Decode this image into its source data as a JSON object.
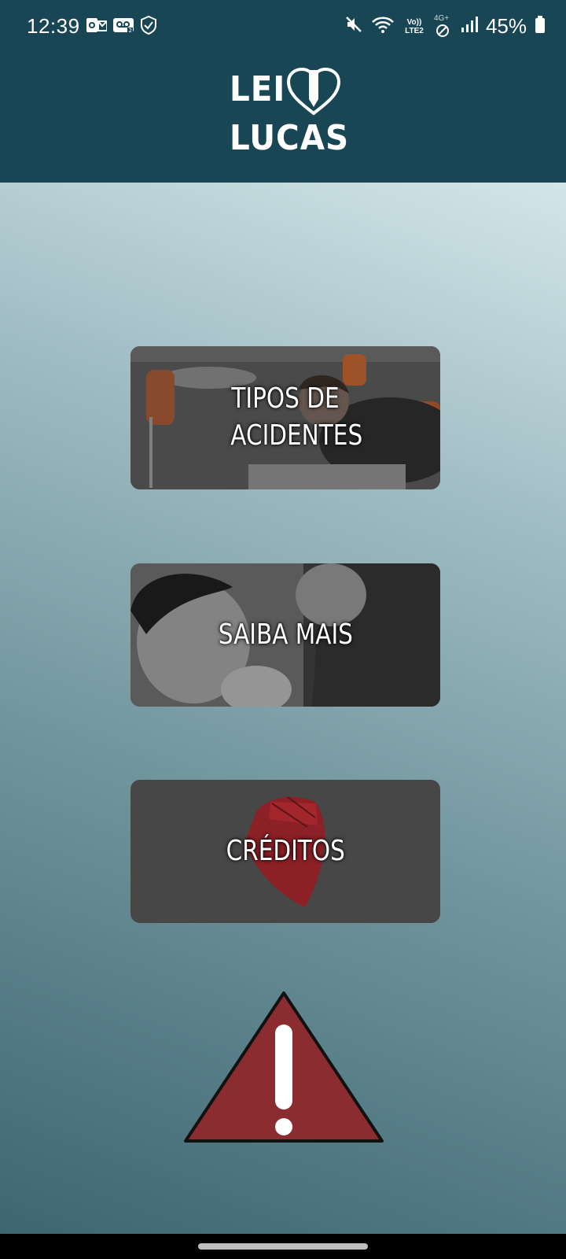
{
  "status_bar": {
    "time": "12:39",
    "battery_percent": "45%",
    "left_icons": [
      "outlook-icon",
      "voicemail-icon",
      "shield-check-icon"
    ],
    "right_icons": [
      "mute-icon",
      "wifi-icon",
      "volte-icon",
      "4g-icon",
      "signal-icon",
      "battery-icon"
    ],
    "volte_label": "Vo)) LTE2",
    "network_label": "4G+"
  },
  "header": {
    "logo_line1": "LEI",
    "logo_line2": "LUCAS",
    "background": "#184654"
  },
  "menu": {
    "items": [
      {
        "label": "TIPOS DE ACIDENTES"
      },
      {
        "label": "SAIBA MAIS"
      },
      {
        "label": "CRÉDITOS"
      }
    ]
  },
  "colors": {
    "accent_red": "#8b2c31",
    "button_gray": "#4a4a4a"
  },
  "warning_icon": "warning-triangle-icon"
}
